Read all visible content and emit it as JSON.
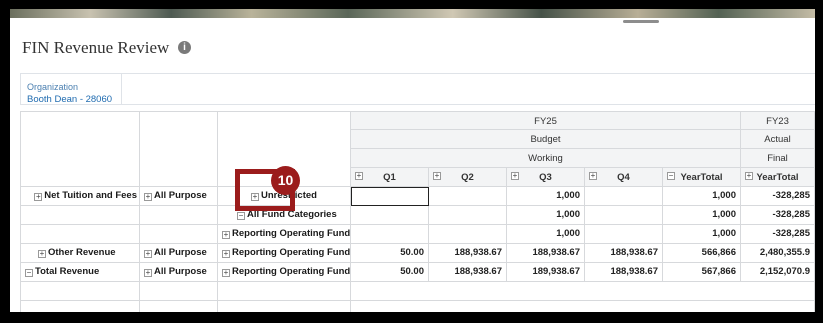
{
  "page": {
    "title": "FIN Revenue Review",
    "info_icon": "info-icon"
  },
  "pov": {
    "label": "Organization",
    "value": "Booth Dean - 28060"
  },
  "column_headers": {
    "years": [
      "FY25",
      "FY23"
    ],
    "scenarios": [
      "Budget",
      "Actual"
    ],
    "versions": [
      "Working",
      "Final"
    ],
    "periods": [
      "Q1",
      "Q2",
      "Q3",
      "Q4",
      "YearTotal",
      "YearTotal"
    ]
  },
  "rows": [
    {
      "account": "Net Tuition and Fees",
      "purpose": "All Purpose",
      "fund": "Unrestricted",
      "values": [
        "",
        "",
        "1,000",
        "",
        "1,000",
        "-328,285"
      ]
    },
    {
      "account": "",
      "purpose": "",
      "fund": "All Fund Categories",
      "values": [
        "",
        "",
        "1,000",
        "",
        "1,000",
        "-328,285"
      ]
    },
    {
      "account": "",
      "purpose": "",
      "fund": "Reporting Operating Fund",
      "values": [
        "",
        "",
        "1,000",
        "",
        "1,000",
        "-328,285"
      ]
    },
    {
      "account": "Other Revenue",
      "purpose": "All Purpose",
      "fund": "Reporting Operating Fund",
      "values": [
        "50.00",
        "188,938.67",
        "188,938.67",
        "188,938.67",
        "566,866",
        "2,480,355.9"
      ]
    },
    {
      "account": "Total Revenue",
      "purpose": "All Purpose",
      "fund": "Reporting Operating Fund",
      "values": [
        "50.00",
        "188,938.67",
        "189,938.67",
        "188,938.67",
        "567,866",
        "2,152,070.9"
      ]
    }
  ],
  "callout": {
    "number": "10",
    "color": "#9b1c1c"
  }
}
